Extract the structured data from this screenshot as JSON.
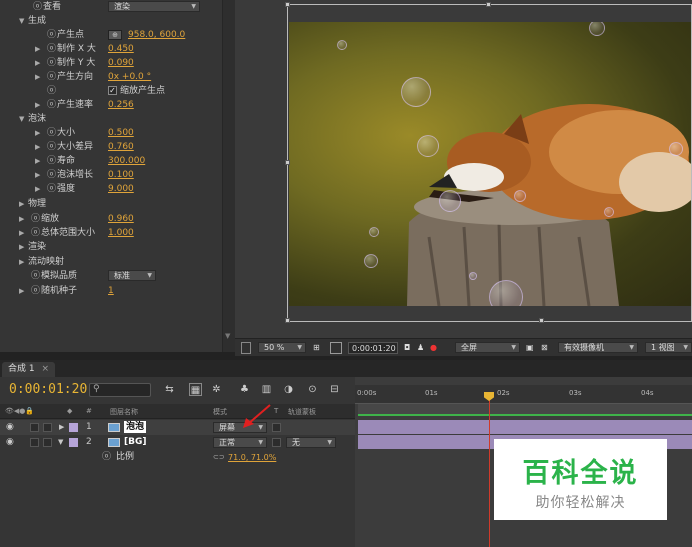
{
  "effect_controls": {
    "rows": [
      {
        "label": "查看",
        "dropdown": "渲染"
      },
      {
        "label": "生成"
      },
      {
        "label": "产生点",
        "value": "958.0, 600.0"
      },
      {
        "label": "制作 X 大",
        "value": "0.450"
      },
      {
        "label": "制作 Y 大",
        "value": "0.090"
      },
      {
        "label": "产生方向",
        "value": "0x +0.0 °"
      },
      {
        "label": "缩放产生点"
      },
      {
        "label": "产生速率",
        "value": "0.256"
      },
      {
        "label": "泡沫"
      },
      {
        "label": "大小",
        "value": "0.500"
      },
      {
        "label": "大小差异",
        "value": "0.760"
      },
      {
        "label": "寿命",
        "value": "300.000"
      },
      {
        "label": "泡沫增长",
        "value": "0.100"
      },
      {
        "label": "强度",
        "value": "9.000"
      },
      {
        "label": "物理"
      },
      {
        "label": "缩放",
        "value": "0.960"
      },
      {
        "label": "总体范围大小",
        "value": "1.000"
      },
      {
        "label": "渲染"
      },
      {
        "label": "流动映射"
      },
      {
        "label": "模拟品质",
        "dropdown": "标准"
      },
      {
        "label": "随机种子",
        "value": "1"
      }
    ]
  },
  "viewer_bar": {
    "zoom": "50 %",
    "timecode": "0:00:01:20",
    "resolution": "全屏",
    "camera": "有效摄像机",
    "views": "1 视图"
  },
  "timeline": {
    "tab_label": "合成 1",
    "tab_close": "×",
    "current_time": "0:00:01:20",
    "columns": {
      "source_name": "图层名称",
      "mode": "模式",
      "t": "T",
      "track_matte": "轨道蒙板",
      "num": "#"
    },
    "ruler_ticks": [
      "0:00s",
      "01s",
      "02s",
      "03s",
      "04s"
    ],
    "layers": [
      {
        "num": "1",
        "name": "泡泡",
        "mode": "屏幕"
      },
      {
        "num": "2",
        "name": "[BG]",
        "mode": "正常",
        "matte": "无"
      }
    ],
    "scale_property": {
      "label": "比例",
      "value": "71.0, 71.0%"
    }
  },
  "watermark": {
    "title": "百科全说",
    "subtitle": "助你轻松解决"
  },
  "colors": {
    "accent_value": "#e0a43a",
    "timecode": "#e8b534",
    "cti": "#d03a2a",
    "watermark_green": "#2bb34a"
  }
}
